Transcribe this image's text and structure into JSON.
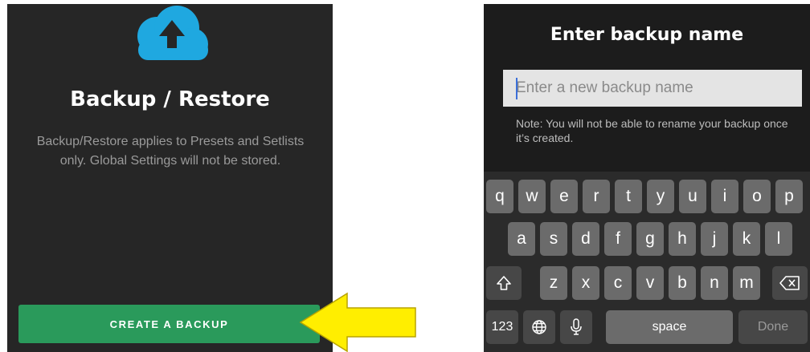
{
  "left": {
    "icon": "cloud-upload-icon",
    "title": "Backup / Restore",
    "description": "Backup/Restore applies to Presets and Setlists only. Global Settings will not be stored.",
    "button_label": "CREATE A BACKUP",
    "colors": {
      "background": "#262626",
      "button": "#2a9a5b",
      "cloud": "#1fa8e0"
    }
  },
  "annotation": {
    "icon": "yellow-arrow-icon",
    "color": "#ffee00"
  },
  "right": {
    "title": "Enter backup name",
    "input_placeholder": "Enter a new backup name",
    "input_value": "",
    "note": "Note: You will not be able to rename your backup once it’s created.",
    "keyboard": {
      "row1": [
        "q",
        "w",
        "e",
        "r",
        "t",
        "y",
        "u",
        "i",
        "o",
        "p"
      ],
      "row2": [
        "a",
        "s",
        "d",
        "f",
        "g",
        "h",
        "j",
        "k",
        "l"
      ],
      "row3": [
        "z",
        "x",
        "c",
        "v",
        "b",
        "n",
        "m"
      ],
      "shift_icon": "shift-icon",
      "delete_icon": "backspace-icon",
      "numbers_label": "123",
      "globe_icon": "globe-icon",
      "mic_icon": "microphone-icon",
      "space_label": "space",
      "done_label": "Done"
    }
  }
}
